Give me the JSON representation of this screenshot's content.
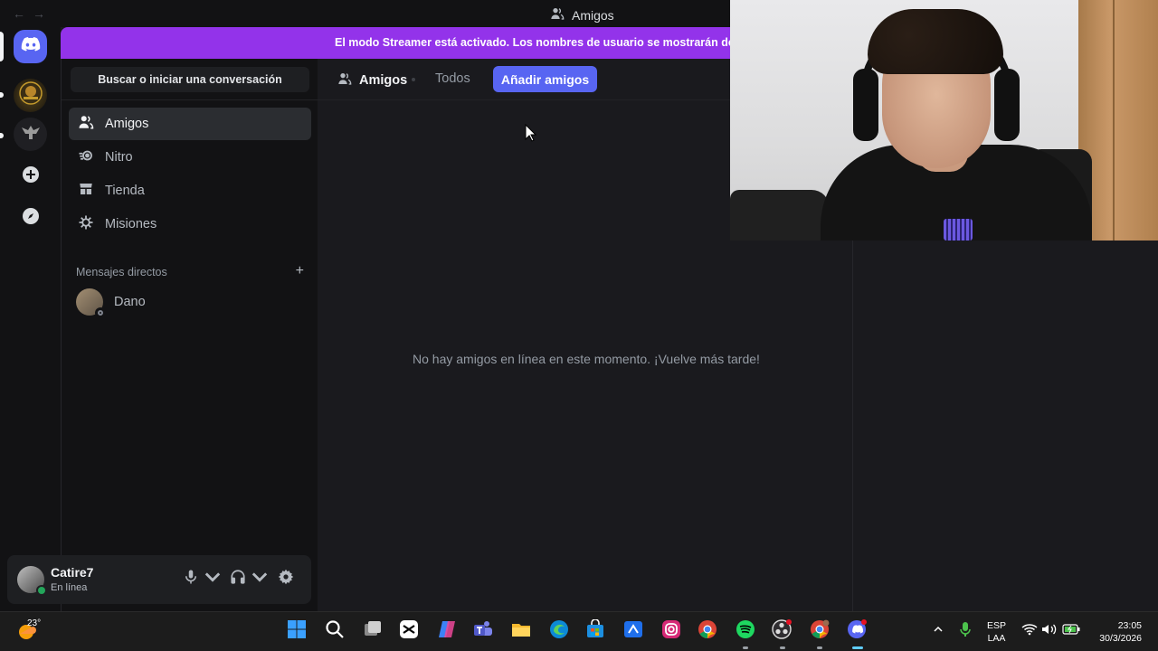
{
  "window": {
    "title": "Amigos"
  },
  "banner": {
    "text": "El modo Streamer está activado. Los nombres de usuario se mostrarán de forma"
  },
  "sidebar": {
    "search_label": "Buscar o iniciar una conversación",
    "nav": [
      {
        "label": "Amigos",
        "icon": "friends-icon"
      },
      {
        "label": "Nitro",
        "icon": "nitro-icon"
      },
      {
        "label": "Tienda",
        "icon": "shop-icon"
      },
      {
        "label": "Misiones",
        "icon": "quests-icon"
      }
    ],
    "dm_header": "Mensajes directos",
    "dm_items": [
      {
        "name": "Dano",
        "status": "offline"
      }
    ]
  },
  "user": {
    "name": "Catire7",
    "status": "En línea"
  },
  "main": {
    "tab_title": "Amigos",
    "tab_all": "Todos",
    "add_friend": "Añadir amigos",
    "empty_text": "No hay amigos en línea en este momento. ¡Vuelve más tarde!"
  },
  "taskbar": {
    "temperature": "23°",
    "lang_line1": "ESP",
    "lang_line2": "LAA",
    "time": "23:05",
    "date": "30/3/2026"
  },
  "colors": {
    "blurple": "#5865f2",
    "banner": "#9333ea",
    "online": "#23a55a"
  }
}
